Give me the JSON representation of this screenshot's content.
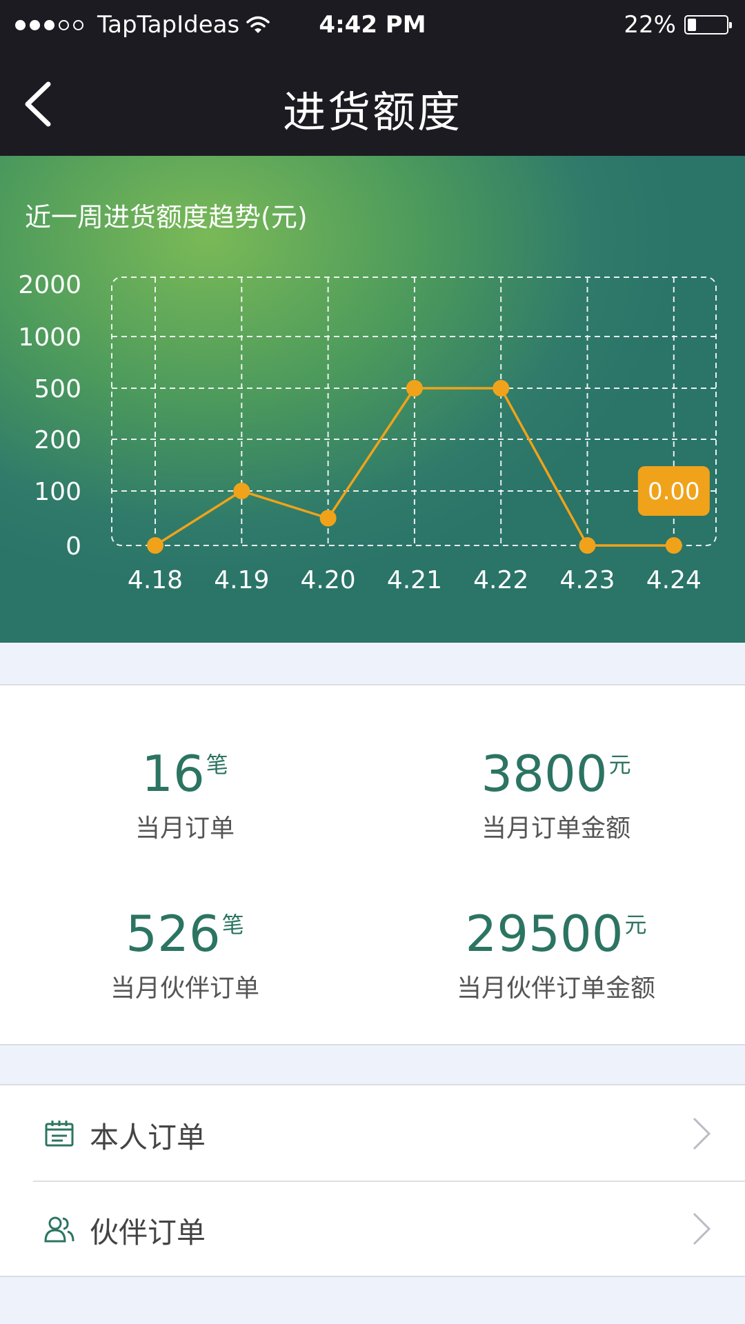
{
  "status_bar": {
    "carrier": "TapTapIdeas",
    "time": "4:42 PM",
    "battery_percent": "22%",
    "battery_level": 0.22,
    "signal_bars_filled": 3,
    "signal_bars_total": 5
  },
  "nav": {
    "back_icon": "chevron-left-icon",
    "title": "进货额度"
  },
  "chart_data": {
    "type": "line",
    "title": "近一周进货额度趋势(元)",
    "categories": [
      "4.18",
      "4.19",
      "4.20",
      "4.21",
      "4.22",
      "4.23",
      "4.24"
    ],
    "y_ticks": [
      "0",
      "100",
      "200",
      "500",
      "1000",
      "2000"
    ],
    "y_scale": "categorical-nonlinear",
    "values": [
      0,
      100,
      50,
      500,
      500,
      0,
      0
    ],
    "tooltip": {
      "category": "4.24",
      "text": "0.00"
    },
    "grid": true,
    "colors": {
      "line": "#f0a31a",
      "tooltip_bg": "#f0a31a",
      "grid": "#ffffff"
    }
  },
  "stats": [
    {
      "value": "16",
      "unit": "笔",
      "label": "当月订单"
    },
    {
      "value": "3800",
      "unit": "元",
      "label": "当月订单金额"
    },
    {
      "value": "526",
      "unit": "笔",
      "label": "当月伙伴订单"
    },
    {
      "value": "29500",
      "unit": "元",
      "label": "当月伙伴订单金额"
    }
  ],
  "menu": [
    {
      "label": "本人订单",
      "icon": "calendar-icon"
    },
    {
      "label": "伙伴订单",
      "icon": "users-icon"
    }
  ],
  "colors": {
    "accent": "#2c7462",
    "bar_bg": "#1b1b21",
    "page_bg": "#eef3fb"
  }
}
